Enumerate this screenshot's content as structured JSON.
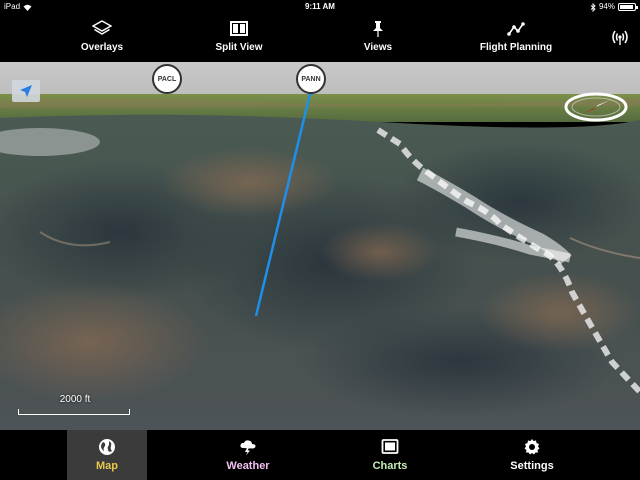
{
  "status_bar": {
    "device": "iPad",
    "time": "9:11 AM",
    "battery_percent_label": "94%",
    "battery_level": 0.94
  },
  "toolbar": {
    "overlays_label": "Overlays",
    "split_view_label": "Split View",
    "views_label": "Views",
    "flight_planning_label": "Flight Planning"
  },
  "map": {
    "airports": [
      {
        "code": "PACL"
      },
      {
        "code": "PANN"
      }
    ],
    "scale_label": "2000 ft",
    "route_color": "#1e8fea"
  },
  "tabs": [
    {
      "label": "Map",
      "color": "#e8c84a",
      "selected": true
    },
    {
      "label": "Weather",
      "color": "#f0c0f0",
      "selected": false
    },
    {
      "label": "Charts",
      "color": "#c4ecb4",
      "selected": false
    },
    {
      "label": "Settings",
      "color": "#ffffff",
      "selected": false
    }
  ]
}
